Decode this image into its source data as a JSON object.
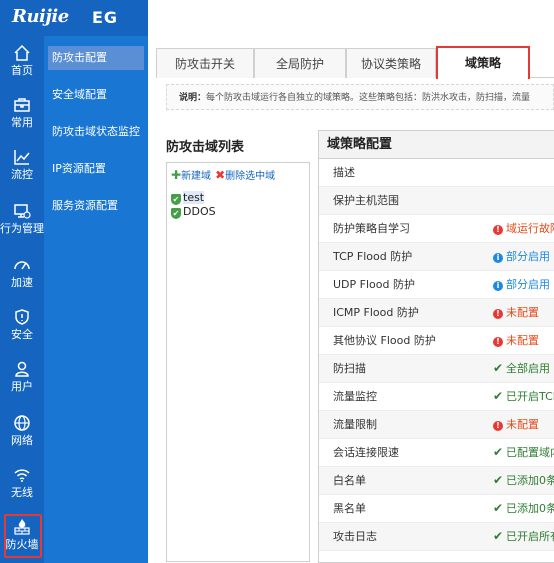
{
  "brand": {
    "logo": "Ruijie",
    "product": "EG"
  },
  "rail": [
    {
      "label": "首页",
      "icon": "home-icon"
    },
    {
      "label": "常用",
      "icon": "briefcase-icon"
    },
    {
      "label": "流控",
      "icon": "chart-line-icon"
    },
    {
      "label": "行为管理",
      "icon": "monitor-settings-icon"
    },
    {
      "label": "加速",
      "icon": "speedometer-icon"
    },
    {
      "label": "安全",
      "icon": "shield-icon"
    },
    {
      "label": "用户",
      "icon": "user-icon"
    },
    {
      "label": "网络",
      "icon": "globe-icon"
    },
    {
      "label": "无线",
      "icon": "wifi-icon"
    },
    {
      "label": "防火墙",
      "icon": "firewall-icon"
    }
  ],
  "submenu": [
    {
      "label": "防攻击配置"
    },
    {
      "label": "安全域配置"
    },
    {
      "label": "防攻击域状态监控"
    },
    {
      "label": "IP资源配置"
    },
    {
      "label": "服务资源配置"
    }
  ],
  "tabs": [
    {
      "label": "防攻击开关"
    },
    {
      "label": "全局防护"
    },
    {
      "label": "协议类策略"
    },
    {
      "label": "域策略"
    }
  ],
  "notice": {
    "prefix": "说明：",
    "text": "每个防攻击域运行各自独立的域策略。这些策略包括：防洪水攻击，防扫描，流量"
  },
  "zone_list": {
    "title": "防攻击域列表",
    "new_label": "新建域",
    "delete_label": "删除选中域",
    "items": [
      "test",
      "DDOS"
    ]
  },
  "policy": {
    "title": "域策略配置",
    "rows": [
      {
        "key": "描述",
        "status": "",
        "tone": ""
      },
      {
        "key": "保护主机范围",
        "status": "",
        "tone": ""
      },
      {
        "key": "防护策略自学习",
        "status": "域运行故障",
        "tone": "red"
      },
      {
        "key": "TCP Flood 防护",
        "status": "部分启用",
        "tone": "blue"
      },
      {
        "key": "UDP Flood 防护",
        "status": "部分启用",
        "tone": "blue"
      },
      {
        "key": "ICMP Flood 防护",
        "status": "未配置",
        "tone": "red"
      },
      {
        "key": "其他协议 Flood 防护",
        "status": "未配置",
        "tone": "red"
      },
      {
        "key": "防扫描",
        "status": "全部启用",
        "tone": "green"
      },
      {
        "key": "流量监控",
        "status": "已开启TCP",
        "tone": "green"
      },
      {
        "key": "流量限制",
        "status": "未配置",
        "tone": "red"
      },
      {
        "key": "会话连接限速",
        "status": "已配置域内",
        "tone": "green"
      },
      {
        "key": "白名单",
        "status": "已添加0条",
        "tone": "green"
      },
      {
        "key": "黑名单",
        "status": "已添加0条",
        "tone": "green"
      },
      {
        "key": "攻击日志",
        "status": "已开启所有",
        "tone": "green"
      }
    ]
  }
}
